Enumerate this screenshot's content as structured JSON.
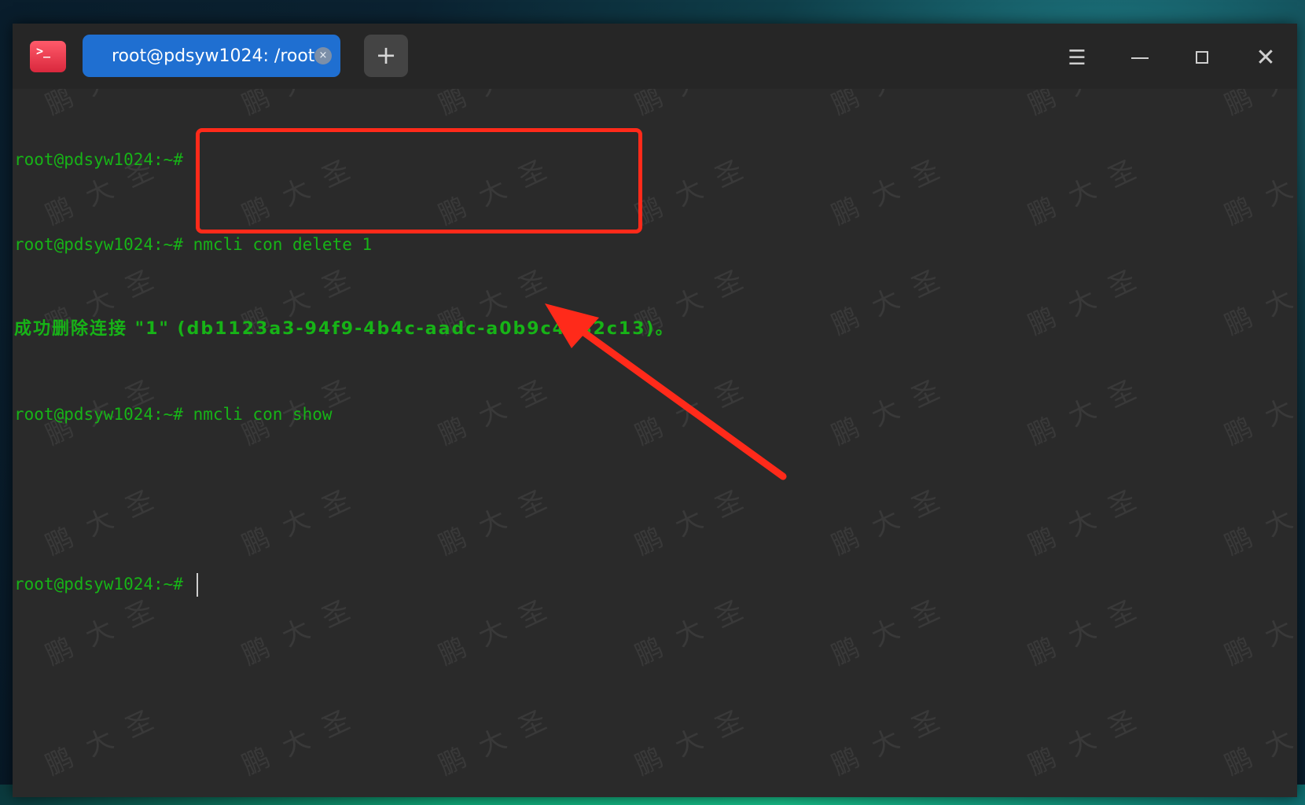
{
  "window": {
    "tab_title": "root@pdsyw1024: /root",
    "tab_close_icon": "×",
    "new_tab_icon": "+",
    "menu_icon": "☰",
    "close_icon": "✕",
    "app_icon_glyph": ">_"
  },
  "terminal": {
    "lines": [
      "root@pdsyw1024:~#",
      "root@pdsyw1024:~# nmcli con delete 1",
      "成功删除连接 \"1\" (db1123a3-94f9-4b4c-aadc-a0b9c4382c13)。",
      "root@pdsyw1024:~# nmcli con show",
      "",
      "root@pdsyw1024:~# "
    ]
  },
  "watermark": {
    "text": "鹏大圣"
  },
  "colors": {
    "terminal_text": "#17b317",
    "tab_active": "#1f6fd1",
    "annotation_red": "#ff2a1a",
    "background": "#2a2a2a"
  }
}
